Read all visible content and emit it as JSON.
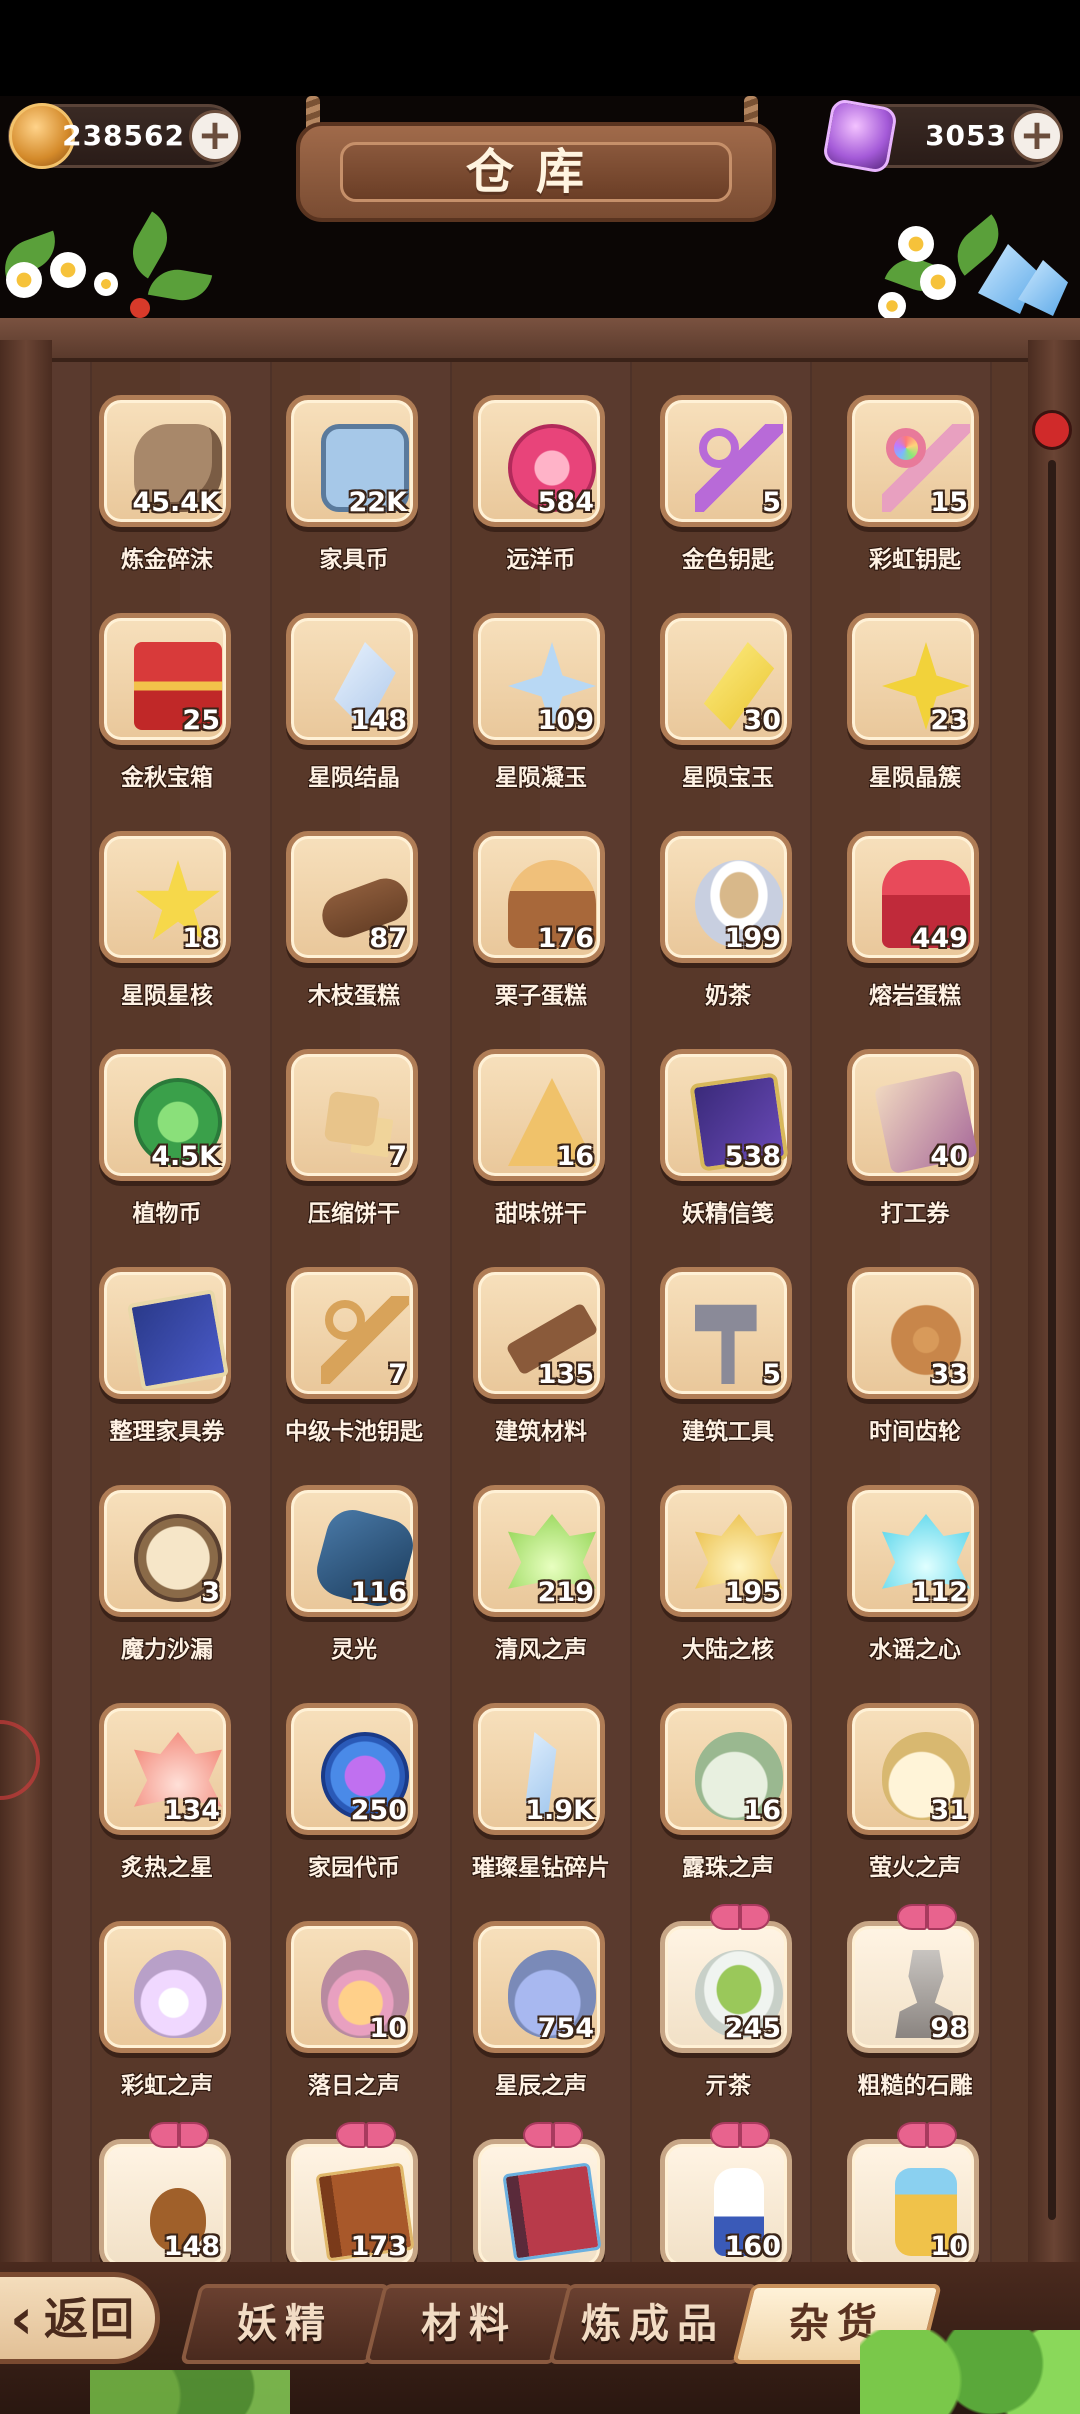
{
  "title": "仓库",
  "currency": {
    "gold": "238562",
    "gem": "3053",
    "add_label": "+"
  },
  "rows": [
    [
      {
        "name": "炼金碎沫",
        "count": "45.4K",
        "icon": "rubble-icon"
      },
      {
        "name": "家具币",
        "count": "22K",
        "icon": "furniture-coin-icon"
      },
      {
        "name": "远洋币",
        "count": "584",
        "icon": "ocean-coin-icon"
      },
      {
        "name": "金色钥匙",
        "count": "5",
        "icon": "gold-key-icon"
      },
      {
        "name": "彩虹钥匙",
        "count": "15",
        "icon": "rainbow-key-icon"
      }
    ],
    [
      {
        "name": "金秋宝箱",
        "count": "25",
        "icon": "treasure-chest-icon"
      },
      {
        "name": "星陨结晶",
        "count": "148",
        "icon": "crystal-icon"
      },
      {
        "name": "星陨凝玉",
        "count": "109",
        "icon": "blue-star-icon"
      },
      {
        "name": "星陨宝玉",
        "count": "30",
        "icon": "yellow-gem-icon"
      },
      {
        "name": "星陨晶簇",
        "count": "23",
        "icon": "yellow-star-icon"
      }
    ],
    [
      {
        "name": "星陨星核",
        "count": "18",
        "icon": "star-core-icon"
      },
      {
        "name": "木枝蛋糕",
        "count": "87",
        "icon": "log-cake-icon"
      },
      {
        "name": "栗子蛋糕",
        "count": "176",
        "icon": "chestnut-cake-icon"
      },
      {
        "name": "奶茶",
        "count": "199",
        "icon": "milk-tea-icon"
      },
      {
        "name": "熔岩蛋糕",
        "count": "449",
        "icon": "lava-cake-icon"
      }
    ],
    [
      {
        "name": "植物币",
        "count": "4.5K",
        "icon": "plant-coin-icon"
      },
      {
        "name": "压缩饼干",
        "count": "7",
        "icon": "cracker-icon"
      },
      {
        "name": "甜味饼干",
        "count": "16",
        "icon": "sweet-cookie-icon"
      },
      {
        "name": "妖精信笺",
        "count": "538",
        "icon": "fairy-letter-icon"
      },
      {
        "name": "打工券",
        "count": "40",
        "icon": "work-ticket-icon"
      }
    ],
    [
      {
        "name": "整理家具券",
        "count": "",
        "icon": "furniture-ticket-icon"
      },
      {
        "name": "中级卡池钥匙",
        "count": "7",
        "icon": "card-pool-key-icon"
      },
      {
        "name": "建筑材料",
        "count": "135",
        "icon": "building-material-icon"
      },
      {
        "name": "建筑工具",
        "count": "5",
        "icon": "hammer-icon"
      },
      {
        "name": "时间齿轮",
        "count": "33",
        "icon": "gear-icon"
      }
    ],
    [
      {
        "name": "魔力沙漏",
        "count": "3",
        "icon": "hourglass-icon"
      },
      {
        "name": "灵光",
        "count": "116",
        "icon": "spirit-light-icon"
      },
      {
        "name": "清风之声",
        "count": "219",
        "icon": "wind-leaf-icon"
      },
      {
        "name": "大陆之核",
        "count": "195",
        "icon": "gold-leaf-icon"
      },
      {
        "name": "水谣之心",
        "count": "112",
        "icon": "aqua-leaf-icon"
      }
    ],
    [
      {
        "name": "炙热之星",
        "count": "134",
        "icon": "red-leaf-icon"
      },
      {
        "name": "家园代币",
        "count": "250",
        "icon": "home-token-icon"
      },
      {
        "name": "璀璨星钻碎片",
        "count": "1.9K",
        "icon": "diamond-shard-icon"
      },
      {
        "name": "露珠之声",
        "count": "16",
        "icon": "dew-bottle-icon"
      },
      {
        "name": "萤火之声",
        "count": "31",
        "icon": "firefly-bottle-icon"
      }
    ],
    [
      {
        "name": "彩虹之声",
        "count": "",
        "icon": "rainbow-bottle-icon"
      },
      {
        "name": "落日之声",
        "count": "10",
        "icon": "sunset-bottle-icon"
      },
      {
        "name": "星辰之声",
        "count": "754",
        "icon": "star-bottle-icon"
      },
      {
        "name": "亓茶",
        "count": "245",
        "icon": "tea-icon",
        "gift": true
      },
      {
        "name": "粗糙的石雕",
        "count": "98",
        "icon": "stone-statue-icon",
        "gift": true
      }
    ],
    [
      {
        "name": "",
        "count": "148",
        "icon": "guitar-icon",
        "gift": true
      },
      {
        "name": "",
        "count": "173",
        "icon": "brown-book-icon",
        "gift": true
      },
      {
        "name": "",
        "count": "",
        "icon": "red-book-icon",
        "gift": true
      },
      {
        "name": "",
        "count": "160",
        "icon": "milk-bottle-icon",
        "gift": true
      },
      {
        "name": "",
        "count": "10",
        "icon": "honey-jar-icon",
        "gift": true
      }
    ]
  ],
  "nav": {
    "back_label": "返回",
    "tabs": [
      "妖精",
      "材料",
      "炼成品",
      "杂货"
    ],
    "active_tab": 3
  }
}
